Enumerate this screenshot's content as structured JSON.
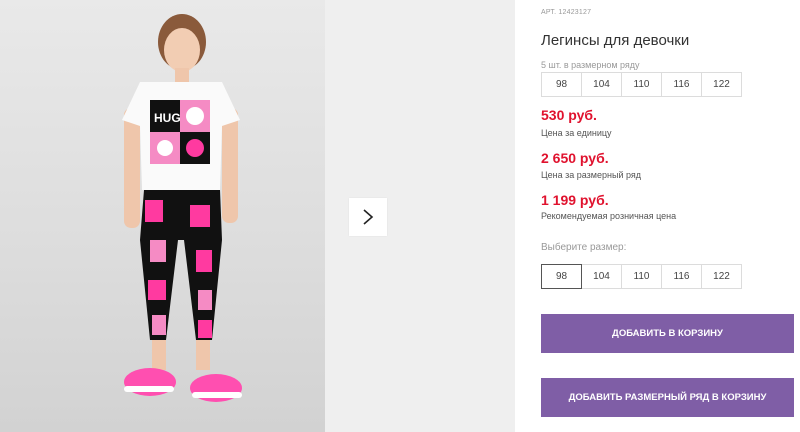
{
  "product": {
    "article": "АРТ. 12423127",
    "title": "Легинсы для девочки",
    "set_note": "5 шт. в размерном ряду",
    "series_sizes": [
      "98",
      "104",
      "110",
      "116",
      "122"
    ],
    "prices": [
      {
        "value": "530 руб.",
        "label": "Цена за единицу"
      },
      {
        "value": "2 650 руб.",
        "label": "Цена за размерный ряд"
      },
      {
        "value": "1 199 руб.",
        "label": "Рекомендуемая розничная цена"
      }
    ],
    "choose_label": "Выберите размер:",
    "choose_sizes": [
      "98",
      "104",
      "110",
      "116",
      "122"
    ],
    "selected_size": "98"
  },
  "buttons": {
    "add_to_cart": "ДОБАВИТЬ В КОРЗИНУ",
    "add_series_to_cart": "ДОБАВИТЬ РАЗМЕРНЫЙ РЯД В КОРЗИНУ"
  },
  "colors": {
    "price_red": "#e0122e",
    "button_purple": "#7f5ea6"
  },
  "icons": {
    "next": "chevron-right-icon"
  },
  "images": {
    "main": "girl in white t-shirt and pink patterned leggings"
  }
}
